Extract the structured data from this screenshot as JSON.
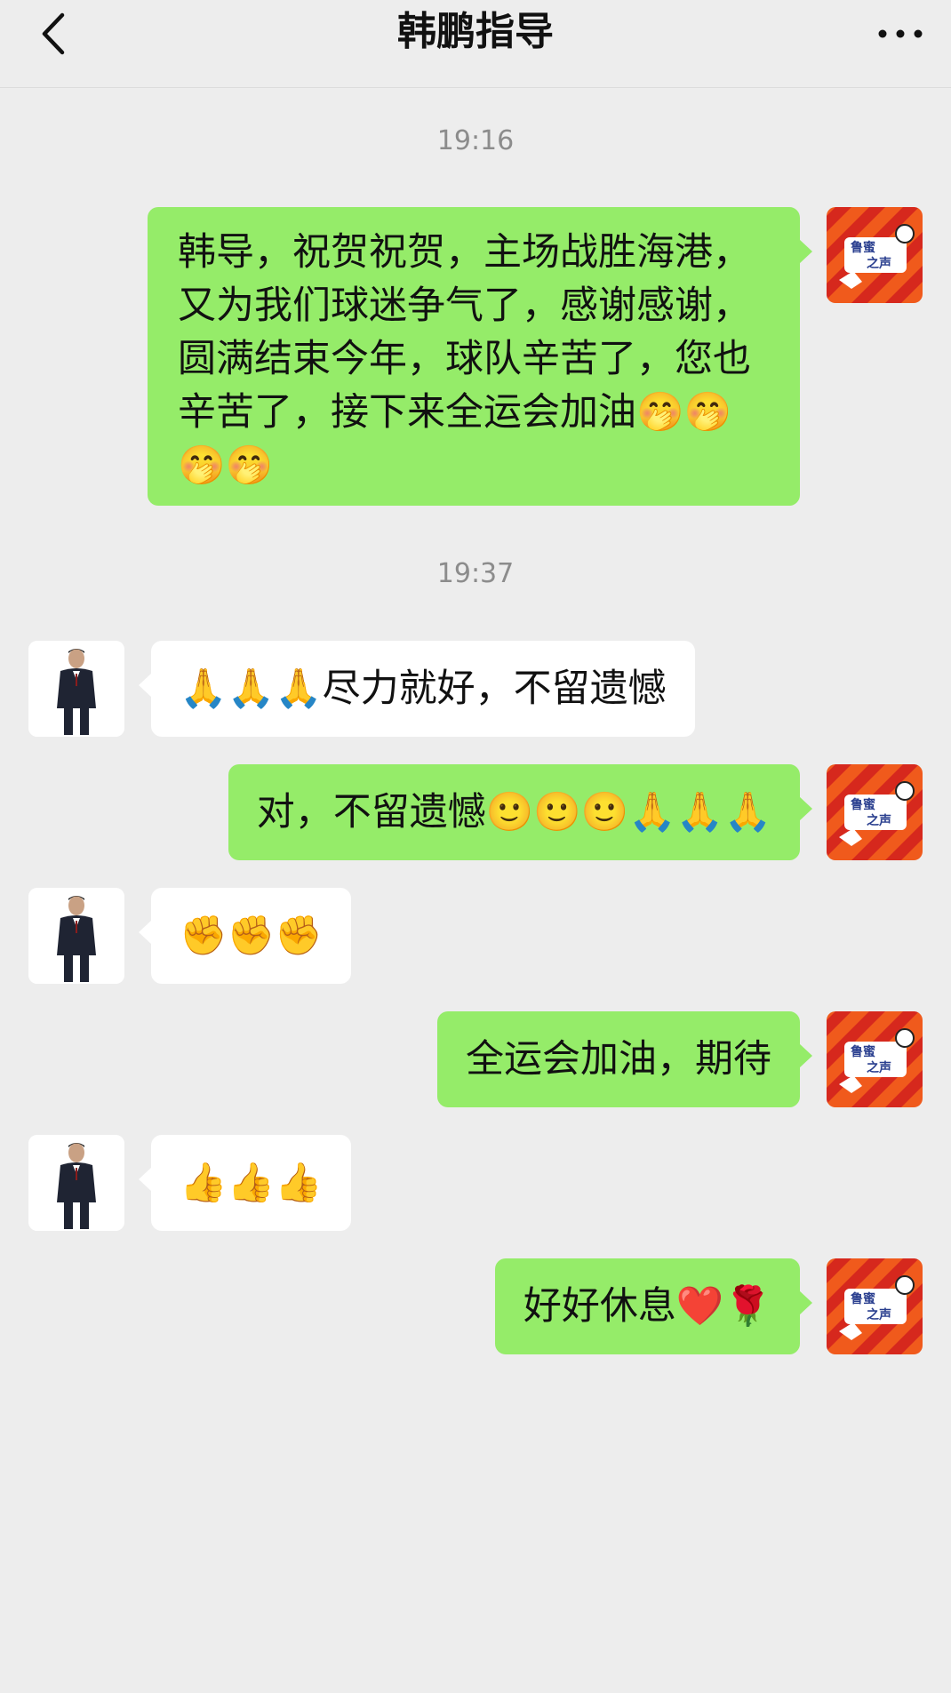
{
  "header": {
    "title": "韩鹏指导"
  },
  "messages": {
    "ts1": "19:16",
    "m1": "韩导，祝贺祝贺，主场战胜海港，又为我们球迷争气了，感谢感谢，圆满结束今年，球队辛苦了，您也辛苦了，接下来全运会加油🤭🤭🤭🤭",
    "ts2": "19:37",
    "m2": "🙏🙏🙏尽力就好，不留遗憾",
    "m3": "对，不留遗憾🙂🙂🙂🙏🙏🙏",
    "m4": "✊✊✊",
    "m5": "全运会加油，期待",
    "m6": "👍👍👍",
    "m7": "好好休息❤️🌹"
  },
  "icons": {
    "back": "chevron-left-icon",
    "more": "more-dots-icon",
    "self_avatar": "avatar-lumi-voice-logo",
    "peer_avatar": "avatar-coach-photo"
  },
  "colors": {
    "background": "#ededed",
    "self_bubble": "#95ec69",
    "peer_bubble": "#ffffff"
  }
}
